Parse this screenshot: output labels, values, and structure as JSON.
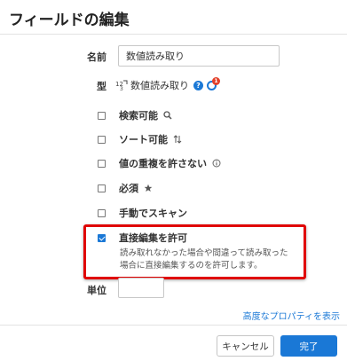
{
  "dialog": {
    "title": "フィールドの編集"
  },
  "form": {
    "name_label": "名前",
    "name_value": "数値読み取り",
    "type_label": "型",
    "type_value": "数値読み取り",
    "type_help_glyph": "?",
    "type_badge_count": "1",
    "unit_label": "単位",
    "unit_value": ""
  },
  "options": [
    {
      "label": "検索可能",
      "checked": false,
      "icon": "search-icon"
    },
    {
      "label": "ソート可能",
      "checked": false,
      "icon": "sort-icon"
    },
    {
      "label": "値の重複を許さない",
      "checked": false,
      "icon": "info-icon"
    },
    {
      "label": "必須",
      "checked": false,
      "icon": "star-icon"
    },
    {
      "label": "手動でスキャン",
      "checked": false,
      "icon": ""
    },
    {
      "label": "直接編集を許可",
      "checked": true,
      "icon": ""
    }
  ],
  "direct_edit_description": [
    "読み取れなかった場合や間違って読み取った",
    "場合に直接編集するのを許可します。"
  ],
  "advanced_link": "高度なプロパティを表示",
  "footer": {
    "cancel_label": "キャンセル",
    "ok_label": "完了"
  },
  "colors": {
    "accent": "#1a78d6",
    "highlight": "#e00000",
    "badge": "#e3402a"
  }
}
